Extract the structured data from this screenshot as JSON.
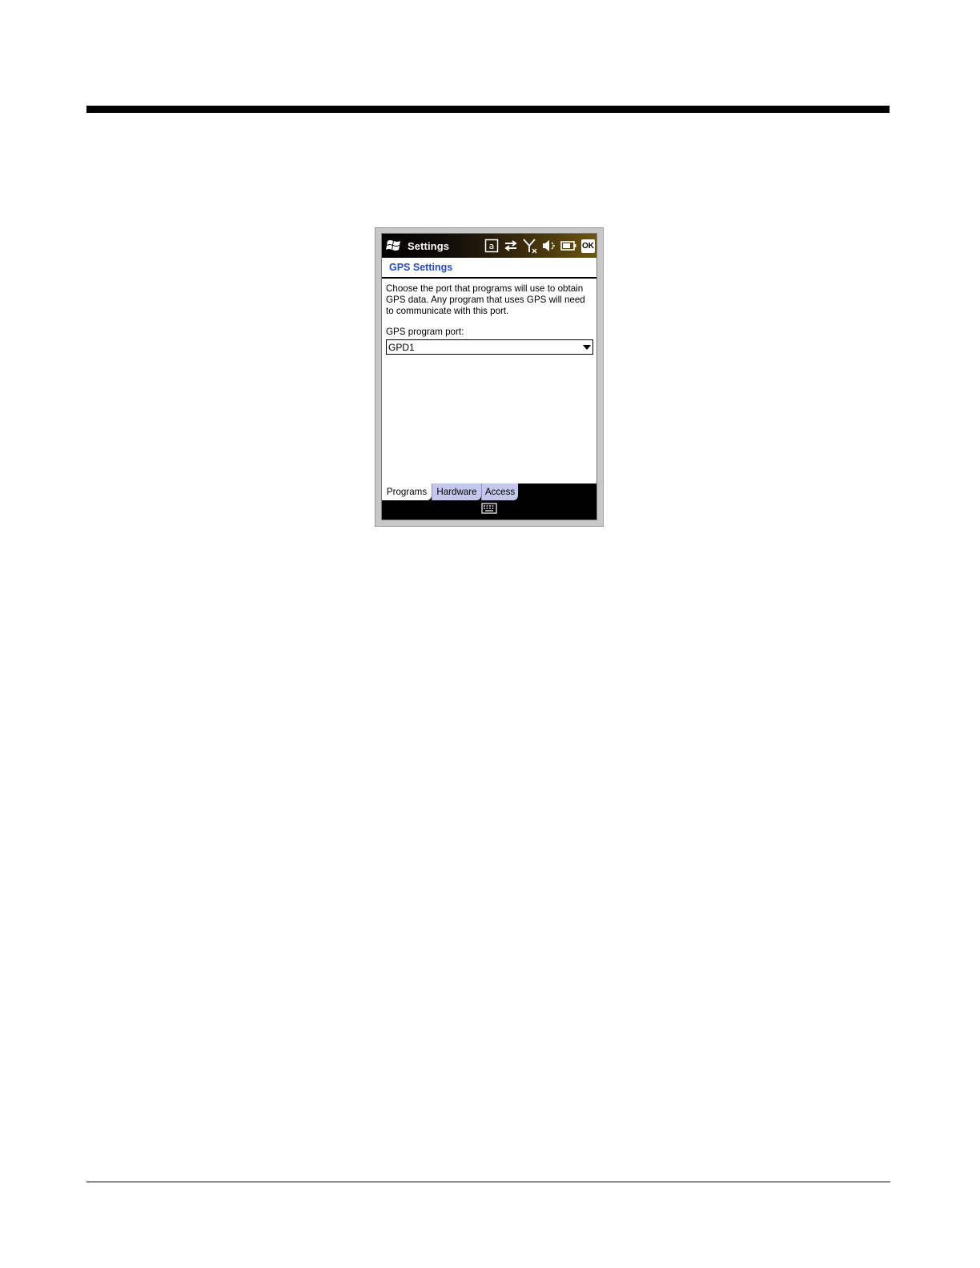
{
  "device": {
    "titlebar": {
      "title": "Settings",
      "ok_label": "OK",
      "icons": [
        "windows-start-icon",
        "input-mode-icon",
        "connectivity-icon",
        "no-signal-icon",
        "volume-muted-icon",
        "battery-icon"
      ]
    },
    "section": {
      "title": "GPS Settings"
    },
    "description": "Choose the port that programs will use to obtain GPS data. Any program that uses GPS will need to communicate with this port.",
    "port": {
      "label": "GPS program port:",
      "selected": "GPD1"
    },
    "tabs": [
      {
        "label": "Programs",
        "active": true
      },
      {
        "label": "Hardware",
        "active": false
      },
      {
        "label": "Access",
        "active": false
      }
    ],
    "softbar": {
      "icon": "keyboard-icon"
    }
  }
}
